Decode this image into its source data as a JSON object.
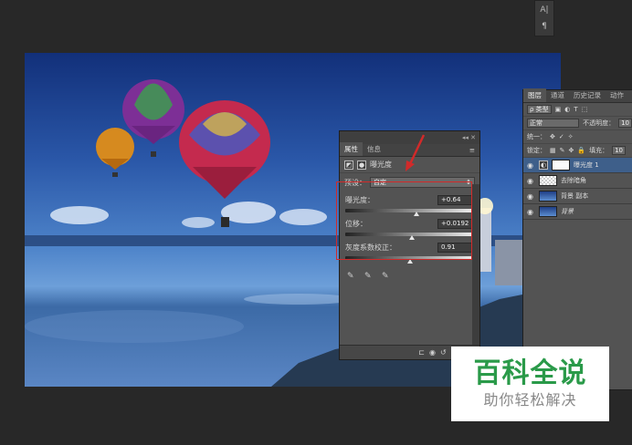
{
  "mini_tools": {
    "glyph_top": "A|",
    "glyph_bottom": "¶"
  },
  "properties": {
    "tabs": [
      "属性",
      "信息"
    ],
    "panel_title": "曝光度",
    "preset_label": "预设：",
    "preset_value": "自定",
    "controls": [
      {
        "label": "曝光度：",
        "value": "+0.64",
        "slider": 0.55
      },
      {
        "label": "位移：",
        "value": "+0.0192",
        "slider": 0.52
      },
      {
        "label": "灰度系数校正：",
        "value": "0.91",
        "slider": 0.5
      }
    ]
  },
  "layers": {
    "tabs": [
      "图层",
      "通道",
      "历史记录",
      "动作"
    ],
    "filter_kind": "ρ 类型",
    "blend_mode": "正常",
    "opacity_label": "不透明度：",
    "opacity_value": "10",
    "unify_label": "统一：",
    "lock_label": "锁定：",
    "fill_label": "填充：",
    "fill_value": "10",
    "items": [
      {
        "name": "曝光度 1",
        "selected": true
      },
      {
        "name": "去除暗角",
        "selected": false
      },
      {
        "name": "背景 副本",
        "selected": false
      },
      {
        "name": "背景",
        "selected": false
      }
    ]
  },
  "watermark": {
    "title": "百科全说",
    "subtitle": "助你轻松解决"
  },
  "colors": {
    "highlight": "#d12a2a",
    "watermark_green": "#2a9a49"
  }
}
